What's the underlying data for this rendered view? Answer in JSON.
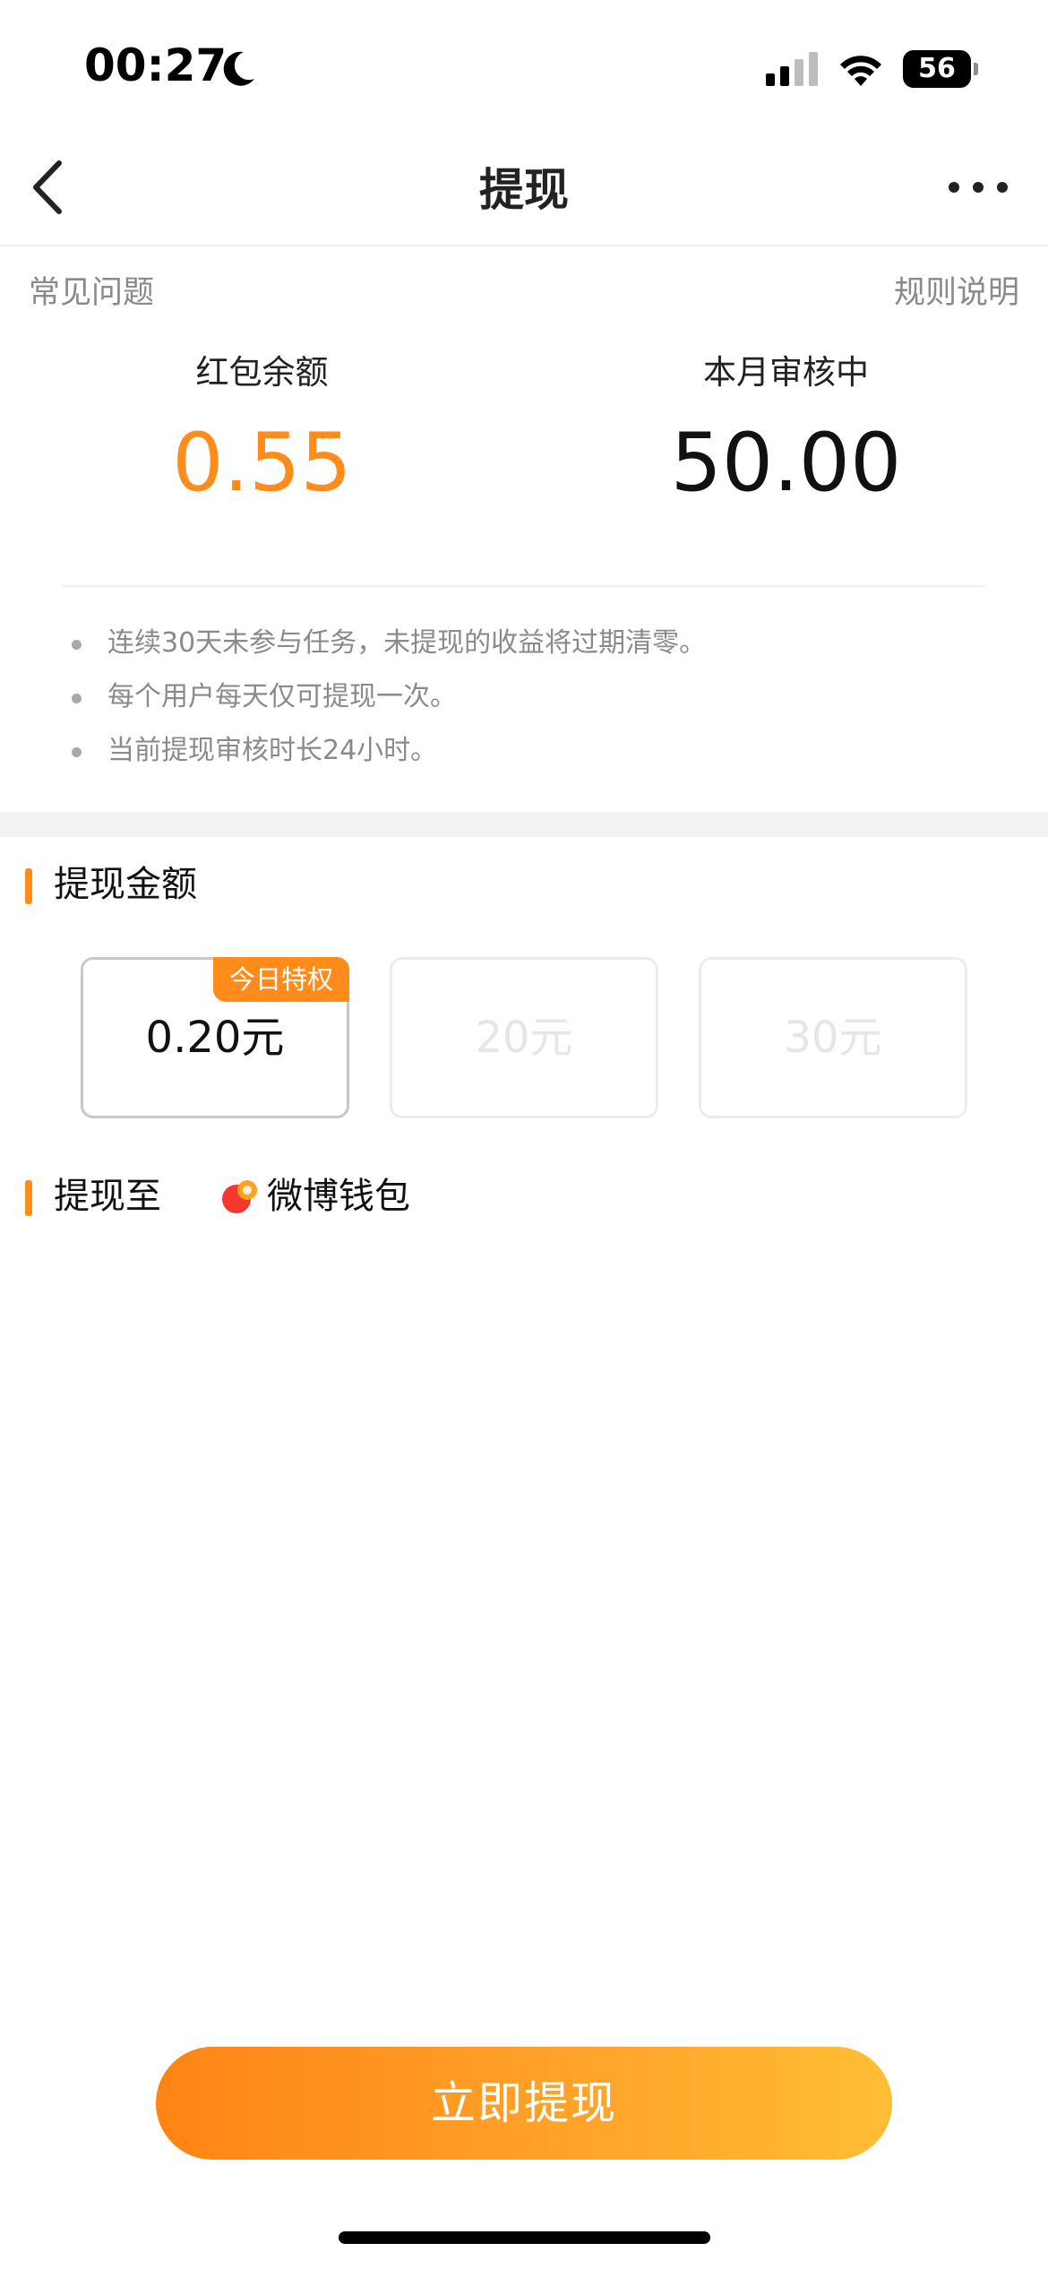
{
  "status_bar": {
    "time": "00:27",
    "battery": "56",
    "icons": [
      "moon-icon",
      "signal-icon",
      "wifi-icon",
      "battery-icon"
    ]
  },
  "nav": {
    "title": "提现",
    "back_icon": "chevron-left-icon",
    "more_icon": "more-dots-icon"
  },
  "links": {
    "faq": "常见问题",
    "rules": "规则说明"
  },
  "balances": {
    "red_packet_label": "红包余额",
    "red_packet_value": "0.55",
    "pending_label": "本月审核中",
    "pending_value": "50.00"
  },
  "notes": [
    "连续30天未参与任务，未提现的收益将过期清零。",
    "每个用户每天仅可提现一次。",
    "当前提现审核时长24小时。"
  ],
  "withdraw_amount": {
    "title": "提现金额",
    "options": [
      {
        "label": "0.20元",
        "badge": "今日特权",
        "selected": true
      },
      {
        "label": "20元",
        "selected": false
      },
      {
        "label": "30元",
        "selected": false
      }
    ]
  },
  "withdraw_to": {
    "title": "提现至",
    "wallet_name": "微博钱包",
    "wallet_icon": "weibo-wallet-icon"
  },
  "cta": {
    "label": "立即提现"
  },
  "colors": {
    "accent": "#ff8c1a",
    "cta_start": "#ff8413",
    "cta_end": "#ffbd35",
    "muted_text": "#8a8a8a"
  }
}
